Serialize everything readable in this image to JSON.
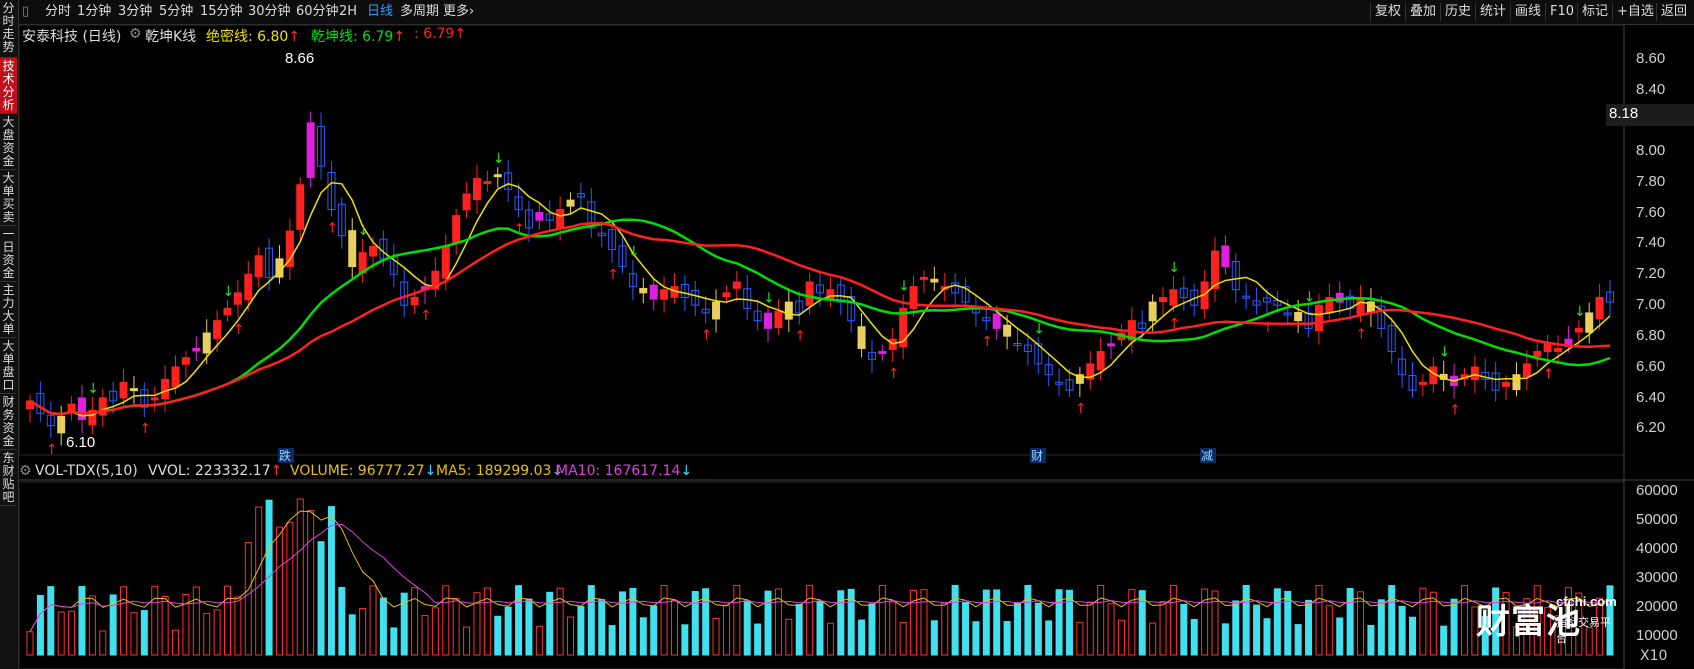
{
  "left_tabs": [
    {
      "label": "分时走势"
    },
    {
      "label": "技术分析"
    },
    {
      "label": "大盘资金"
    },
    {
      "label": "大单买卖"
    },
    {
      "label": "一日资金"
    },
    {
      "label": "主力大单"
    },
    {
      "label": "大单盘口"
    },
    {
      "label": "财务资金"
    },
    {
      "label": "东财贴吧"
    }
  ],
  "toolbar": {
    "periods": [
      "分时",
      "1分钟",
      "3分钟",
      "5分钟",
      "15分钟",
      "30分钟",
      "60分钟",
      "2H",
      "日线",
      "多周期",
      "更多"
    ],
    "active_period": "日线",
    "more_arrow": "›",
    "right_buttons": [
      "复权",
      "叠加",
      "历史",
      "统计",
      "画线",
      "F10",
      "标记",
      "+自选",
      "返回"
    ]
  },
  "main_legend": {
    "stock": "安泰科技 (日线)",
    "indicator": "乾坤K线",
    "line1_label": "绝密线: 6.80",
    "line1_arrow": "↑",
    "line2_label": "乾坤线: 6.79",
    "line2_arrow": "↑",
    "line3_label": ": 6.79",
    "line3_arrow": "↑",
    "colors": {
      "line1": "#f0e000",
      "line2": "#00e000",
      "line3": "#ff2020"
    }
  },
  "volume_legend": {
    "name": "VOL-TDX(5,10)",
    "vvol": "VVOL: 223332.17",
    "vvol_arrow": "↑",
    "volume": "VOLUME: 96777.27",
    "volume_arrow": "↓",
    "ma5": "MA5: 189299.03",
    "ma5_arrow": "↓",
    "ma10": "MA10: 167617.14",
    "ma10_arrow": "↓"
  },
  "price_axis": [
    "8.60",
    "8.40",
    "8.18",
    "8.00",
    "7.80",
    "7.60",
    "7.40",
    "7.20",
    "7.00",
    "6.80",
    "6.60",
    "6.40",
    "6.20"
  ],
  "current_price": "8.18",
  "vol_axis": [
    "60000",
    "50000",
    "40000",
    "30000",
    "20000",
    "10000"
  ],
  "vol_unit": "X10",
  "annotations": {
    "high": "8.66",
    "low": "6.10",
    "markers": [
      "跌",
      "财",
      "减"
    ]
  },
  "logo": {
    "brand": "财富池",
    "url": "cfchi.com",
    "tagline": "指标交易平台"
  },
  "chart_data": {
    "type": "candlestick",
    "closes": [
      6.38,
      6.3,
      6.22,
      6.28,
      6.36,
      6.26,
      6.32,
      6.4,
      6.38,
      6.5,
      6.46,
      6.34,
      6.4,
      6.52,
      6.6,
      6.66,
      6.72,
      6.82,
      6.9,
      6.98,
      7.08,
      7.2,
      7.32,
      7.18,
      7.3,
      7.48,
      7.78,
      8.18,
      7.9,
      7.62,
      7.45,
      7.25,
      7.34,
      7.38,
      7.3,
      7.2,
      7.0,
      7.05,
      7.12,
      7.22,
      7.38,
      7.58,
      7.72,
      7.82,
      7.8,
      7.84,
      7.75,
      7.62,
      7.5,
      7.6,
      7.55,
      7.62,
      7.68,
      7.7,
      7.5,
      7.45,
      7.36,
      7.25,
      7.12,
      7.08,
      7.04,
      7.1,
      7.12,
      7.05,
      7.0,
      6.95,
      7.02,
      7.08,
      7.15,
      6.98,
      6.9,
      6.85,
      6.96,
      7.02,
      6.95,
      7.15,
      7.08,
      7.1,
      7.02,
      6.9,
      6.72,
      6.65,
      6.7,
      6.78,
      6.98,
      7.12,
      7.18,
      7.15,
      7.12,
      7.08,
      7.02,
      6.95,
      6.9,
      6.85,
      6.8,
      6.75,
      6.7,
      6.62,
      6.55,
      6.5,
      6.45,
      6.55,
      6.62,
      6.7,
      6.75,
      6.82,
      6.9,
      6.85,
      7.02,
      7.05,
      7.1,
      7.05,
      7.0,
      7.15,
      7.35,
      7.25,
      7.1,
      7.05,
      7.0,
      7.02,
      7.0,
      6.95,
      6.9,
      6.85,
      7.0,
      7.05,
      7.02,
      6.98,
      7.05,
      6.95,
      6.85,
      6.7,
      6.55,
      6.45,
      6.5,
      6.6,
      6.52,
      6.48,
      6.55,
      6.6,
      6.52,
      6.45,
      6.5,
      6.55,
      6.62,
      6.7,
      6.75,
      6.72,
      6.78,
      6.85,
      6.95,
      7.05,
      7.02
    ],
    "vwindow": "VOL-TDX(5,10)"
  }
}
